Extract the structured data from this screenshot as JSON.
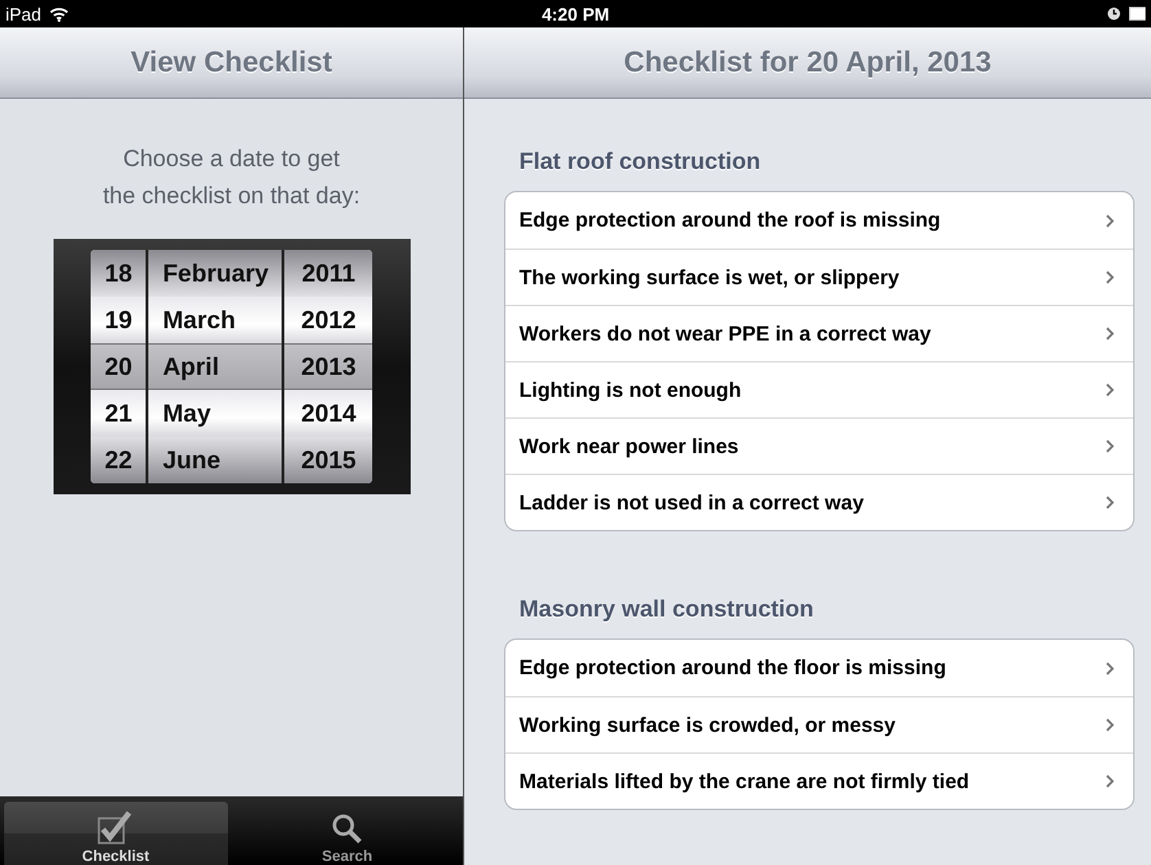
{
  "status_bar": {
    "device": "iPad",
    "time": "4:20 PM"
  },
  "master": {
    "title": "View Checklist",
    "prompt_lines": [
      "Choose a date to get",
      "the checklist on that day:"
    ],
    "picker": {
      "columns": [
        {
          "kind": "day",
          "items": [
            {
              "label": "18",
              "selected": false
            },
            {
              "label": "19",
              "selected": false
            },
            {
              "label": "20",
              "selected": true
            },
            {
              "label": "21",
              "selected": false
            },
            {
              "label": "22",
              "selected": false
            }
          ]
        },
        {
          "kind": "month",
          "items": [
            {
              "label": "February",
              "selected": false
            },
            {
              "label": "March",
              "selected": false
            },
            {
              "label": "April",
              "selected": true
            },
            {
              "label": "May",
              "selected": false
            },
            {
              "label": "June",
              "selected": false
            }
          ]
        },
        {
          "kind": "year",
          "items": [
            {
              "label": "2011",
              "selected": false
            },
            {
              "label": "2012",
              "selected": false
            },
            {
              "label": "2013",
              "selected": true
            },
            {
              "label": "2014",
              "selected": false
            },
            {
              "label": "2015",
              "selected": false
            }
          ]
        }
      ]
    }
  },
  "tab_bar": [
    {
      "label": "Checklist",
      "kind": "checkbox",
      "selected": true
    },
    {
      "label": "Search",
      "kind": "search",
      "selected": false
    }
  ],
  "detail": {
    "title": "Checklist for 20 April, 2013",
    "sections": [
      {
        "header": "Flat roof construction",
        "items": [
          "Edge protection around the roof is missing",
          "The working surface is wet, or slippery",
          "Workers do not wear PPE in a correct way",
          "Lighting is not enough",
          "Work near power lines",
          "Ladder is not used in a correct way"
        ]
      },
      {
        "header": "Masonry wall construction",
        "items": [
          "Edge protection around the floor is missing",
          "Working surface is crowded, or messy",
          "Materials lifted by the crane are not firmly tied"
        ]
      }
    ]
  }
}
